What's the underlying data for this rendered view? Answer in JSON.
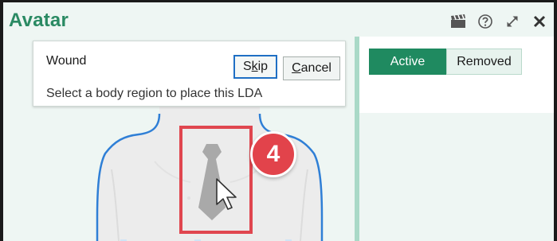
{
  "window": {
    "title": "Avatar",
    "toolbar_icons": [
      "clapperboard-icon",
      "help-icon",
      "expand-icon",
      "close-icon"
    ]
  },
  "prompt": {
    "title": "Wound",
    "message": "Select a body region to place this LDA",
    "skip_label": "Skip",
    "cancel_label": "Cancel"
  },
  "tabs": {
    "active_label": "Active",
    "removed_label": "Removed"
  },
  "callout": {
    "step_number": "4"
  },
  "colors": {
    "brand_green": "#2a8a63",
    "active_tab": "#1f8a60",
    "highlight_red": "#e0464f",
    "focus_blue": "#1f6fc4",
    "body_outline": "#2f7fd6"
  }
}
